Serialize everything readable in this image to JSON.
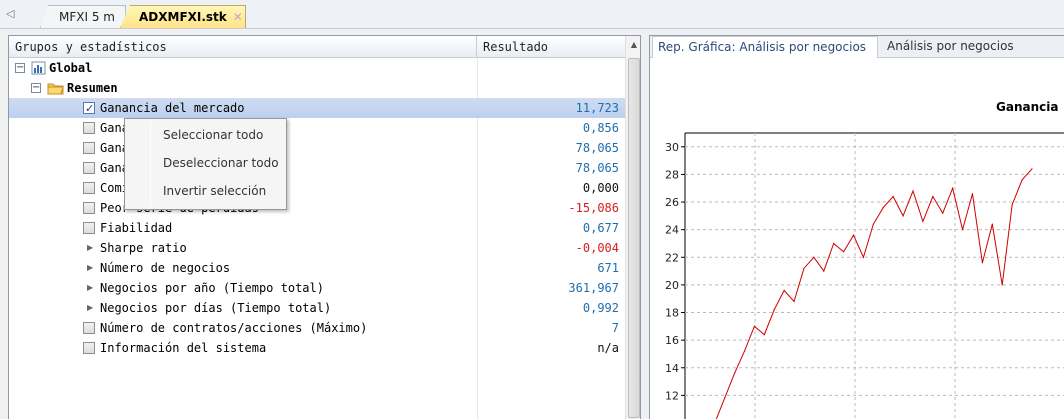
{
  "doc_tabs": [
    {
      "label": "MFXI 5 m",
      "active": false
    },
    {
      "label": "ADXMFXI.stk",
      "active": true,
      "close": "✕"
    }
  ],
  "grid": {
    "header": {
      "name": "Grupos y estadísticos",
      "result": "Resultado"
    },
    "rows": [
      {
        "type": "group",
        "label": "Global",
        "bold": true
      },
      {
        "type": "subgroup",
        "label": "Resumen",
        "bold": true
      },
      {
        "type": "check",
        "checked": true,
        "label": "Ganancia del mercado",
        "value": "11,723",
        "color": "blue",
        "selected": true
      },
      {
        "type": "check",
        "checked": false,
        "label": "Ganancia media",
        "value": "0,856",
        "color": "blue"
      },
      {
        "type": "check",
        "checked": false,
        "label": "Ganancia bruta",
        "value": "78,065",
        "color": "blue"
      },
      {
        "type": "check",
        "checked": false,
        "label": "Ganancia neta",
        "value": "78,065",
        "color": "blue"
      },
      {
        "type": "check",
        "checked": false,
        "label": "Comisiones",
        "value": "0,000",
        "color": "black"
      },
      {
        "type": "check",
        "checked": false,
        "label": "Peor serie de pérdidas",
        "value": "-15,086",
        "color": "red"
      },
      {
        "type": "check",
        "checked": false,
        "label": "Fiabilidad",
        "value": "0,677",
        "color": "blue"
      },
      {
        "type": "expand",
        "label": "Sharpe ratio",
        "value": "-0,004",
        "color": "red"
      },
      {
        "type": "expand",
        "label": "Número de negocios",
        "value": "671",
        "color": "blue"
      },
      {
        "type": "expand",
        "label": "Negocios por año (Tiempo total)",
        "value": "361,967",
        "color": "blue"
      },
      {
        "type": "expand",
        "label": "Negocios por días (Tiempo total)",
        "value": "0,992",
        "color": "blue"
      },
      {
        "type": "check",
        "checked": false,
        "label": "Número de contratos/acciones (Máximo)",
        "value": "7",
        "color": "blue"
      },
      {
        "type": "check",
        "checked": false,
        "label": "Información del sistema",
        "value": "n/a",
        "color": "black"
      }
    ]
  },
  "context_menu": {
    "items": [
      "Seleccionar todo",
      "Deseleccionar todo",
      "Invertir selección"
    ]
  },
  "right_panel": {
    "tabs": [
      {
        "label": "Rep. Gráfica: Análisis por negocios",
        "active": true
      },
      {
        "label": "Análisis por negocios",
        "active": false
      }
    ]
  },
  "chart_data": {
    "type": "line",
    "title": "Ganancia",
    "ylim": [
      10,
      31
    ],
    "yticks": [
      12,
      14,
      16,
      18,
      20,
      22,
      24,
      26,
      28,
      30
    ],
    "grid": true,
    "color": "#d00000",
    "x": [
      0,
      3,
      6,
      9,
      12,
      15,
      18,
      21,
      24,
      27,
      30,
      33,
      36,
      39,
      42,
      45,
      48,
      51,
      54,
      57,
      60,
      63,
      66,
      69,
      72,
      75,
      78,
      81,
      84,
      87,
      90,
      93,
      96
    ],
    "values": [
      10.0,
      11.8,
      13.6,
      15.2,
      17.0,
      16.4,
      18.2,
      19.6,
      18.8,
      21.2,
      22.0,
      21.0,
      23.0,
      22.4,
      23.6,
      22.0,
      24.4,
      25.6,
      26.4,
      25.0,
      26.8,
      24.6,
      26.4,
      25.2,
      27.0,
      24.0,
      26.6,
      21.6,
      24.4,
      20.0,
      25.8,
      27.6,
      28.4
    ]
  }
}
